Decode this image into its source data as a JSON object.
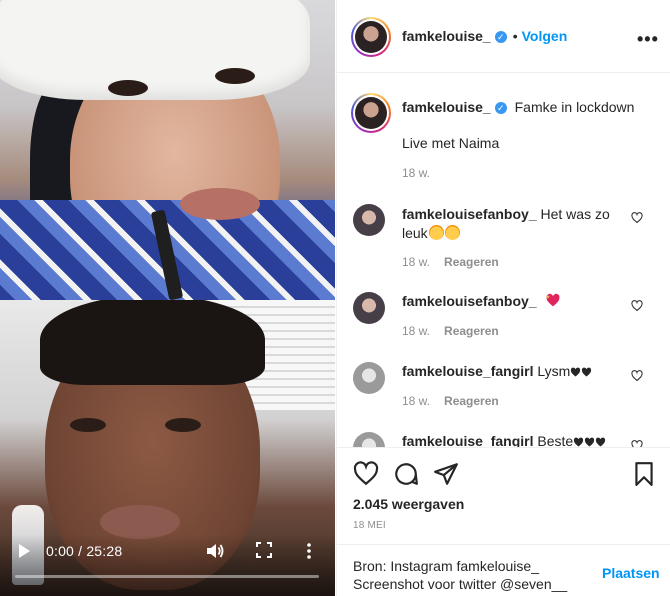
{
  "video": {
    "time": "0:00 / 25:28",
    "progress": 0
  },
  "post": {
    "username": "famkelouise_",
    "follow_label": "Volgen",
    "caption_user": "famkelouise_",
    "caption_title": "Famke in lockdown",
    "caption_body": "Live met Naima",
    "caption_age": "18 w."
  },
  "comments": [
    {
      "user": "famkelouisefanboy_",
      "text": "Het was zo leuk",
      "emojis": [
        "love",
        "love"
      ],
      "age": "18 w.",
      "reply": "Reageren"
    },
    {
      "user": "famkelouisefanboy_",
      "text": "",
      "emojis": [
        "sparkle-heart"
      ],
      "age": "18 w.",
      "reply": "Reageren"
    },
    {
      "user": "famkelouise_fangirl",
      "text": "Lysm",
      "emojis": [
        "black-heart",
        "black-heart"
      ],
      "age": "18 w.",
      "reply": "Reageren"
    },
    {
      "user": "famkelouise_fangirl",
      "text": "Beste",
      "emojis": [
        "black-heart",
        "black-heart",
        "black-heart"
      ],
      "age": "",
      "reply": ""
    }
  ],
  "stats": {
    "views": "2.045 weergaven",
    "date": "18 MEI"
  },
  "compose": {
    "text": "Bron: Instagram famkelouise_ Screenshot voor twitter @seven__",
    "post_label": "Plaatsen"
  },
  "colors": {
    "accent": "#0095f6",
    "verified": "#3897f0",
    "muted": "#8e8e8e"
  },
  "icons": [
    "play-icon",
    "volume-icon",
    "fullscreen-icon",
    "more-vertical-icon",
    "more-horizontal-icon",
    "verified-icon",
    "heart-icon",
    "comment-icon",
    "share-icon",
    "bookmark-icon"
  ]
}
